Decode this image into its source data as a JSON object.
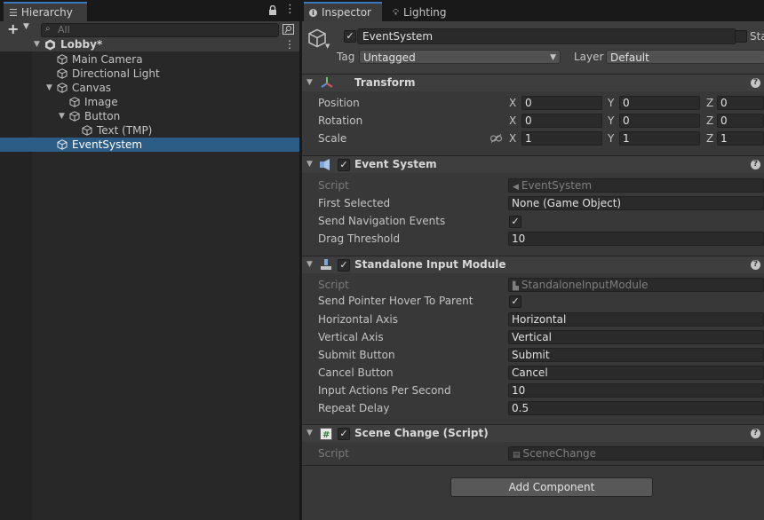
{
  "hierarchy": {
    "tab_label": "Hierarchy",
    "search_placeholder": "All",
    "scene_name": "Lobby*",
    "items": [
      {
        "label": "Main Camera"
      },
      {
        "label": "Directional Light"
      },
      {
        "label": "Canvas"
      },
      {
        "label": "Image"
      },
      {
        "label": "Button"
      },
      {
        "label": "Text (TMP)"
      },
      {
        "label": "EventSystem"
      }
    ]
  },
  "inspector": {
    "tabs": [
      {
        "label": "Inspector"
      },
      {
        "label": "Lighting"
      }
    ],
    "object_name": "EventSystem",
    "static_label": "Sta",
    "tag_label": "Tag",
    "tag_value": "Untagged",
    "layer_label": "Layer",
    "layer_value": "Default",
    "transform": {
      "title": "Transform",
      "position_label": "Position",
      "rotation_label": "Rotation",
      "scale_label": "Scale",
      "position": {
        "x": "0",
        "y": "0",
        "z": "0"
      },
      "rotation": {
        "x": "0",
        "y": "0",
        "z": "0"
      },
      "scale": {
        "x": "1",
        "y": "1",
        "z": "1"
      },
      "axis_x": "X",
      "axis_y": "Y",
      "axis_z": "Z"
    },
    "event_system": {
      "title": "Event System",
      "script_label": "Script",
      "script_value": "EventSystem",
      "first_selected_label": "First Selected",
      "first_selected_value": "None (Game Object)",
      "send_nav_label": "Send Navigation Events",
      "drag_threshold_label": "Drag Threshold",
      "drag_threshold_value": "10"
    },
    "standalone": {
      "title": "Standalone Input Module",
      "script_label": "Script",
      "script_value": "StandaloneInputModule",
      "hover_label": "Send Pointer Hover To Parent",
      "horizontal_label": "Horizontal Axis",
      "horizontal_value": "Horizontal",
      "vertical_label": "Vertical Axis",
      "vertical_value": "Vertical",
      "submit_label": "Submit Button",
      "submit_value": "Submit",
      "cancel_label": "Cancel Button",
      "cancel_value": "Cancel",
      "actions_label": "Input Actions Per Second",
      "actions_value": "10",
      "repeat_label": "Repeat Delay",
      "repeat_value": "0.5"
    },
    "scene_change": {
      "title": "Scene Change (Script)",
      "script_label": "Script",
      "script_value": "SceneChange"
    },
    "add_component": "Add Component",
    "check_mark": "✓",
    "help_mark": "?"
  },
  "colors": {
    "selection": "#2c5d87",
    "accent": "#3a79bb"
  }
}
